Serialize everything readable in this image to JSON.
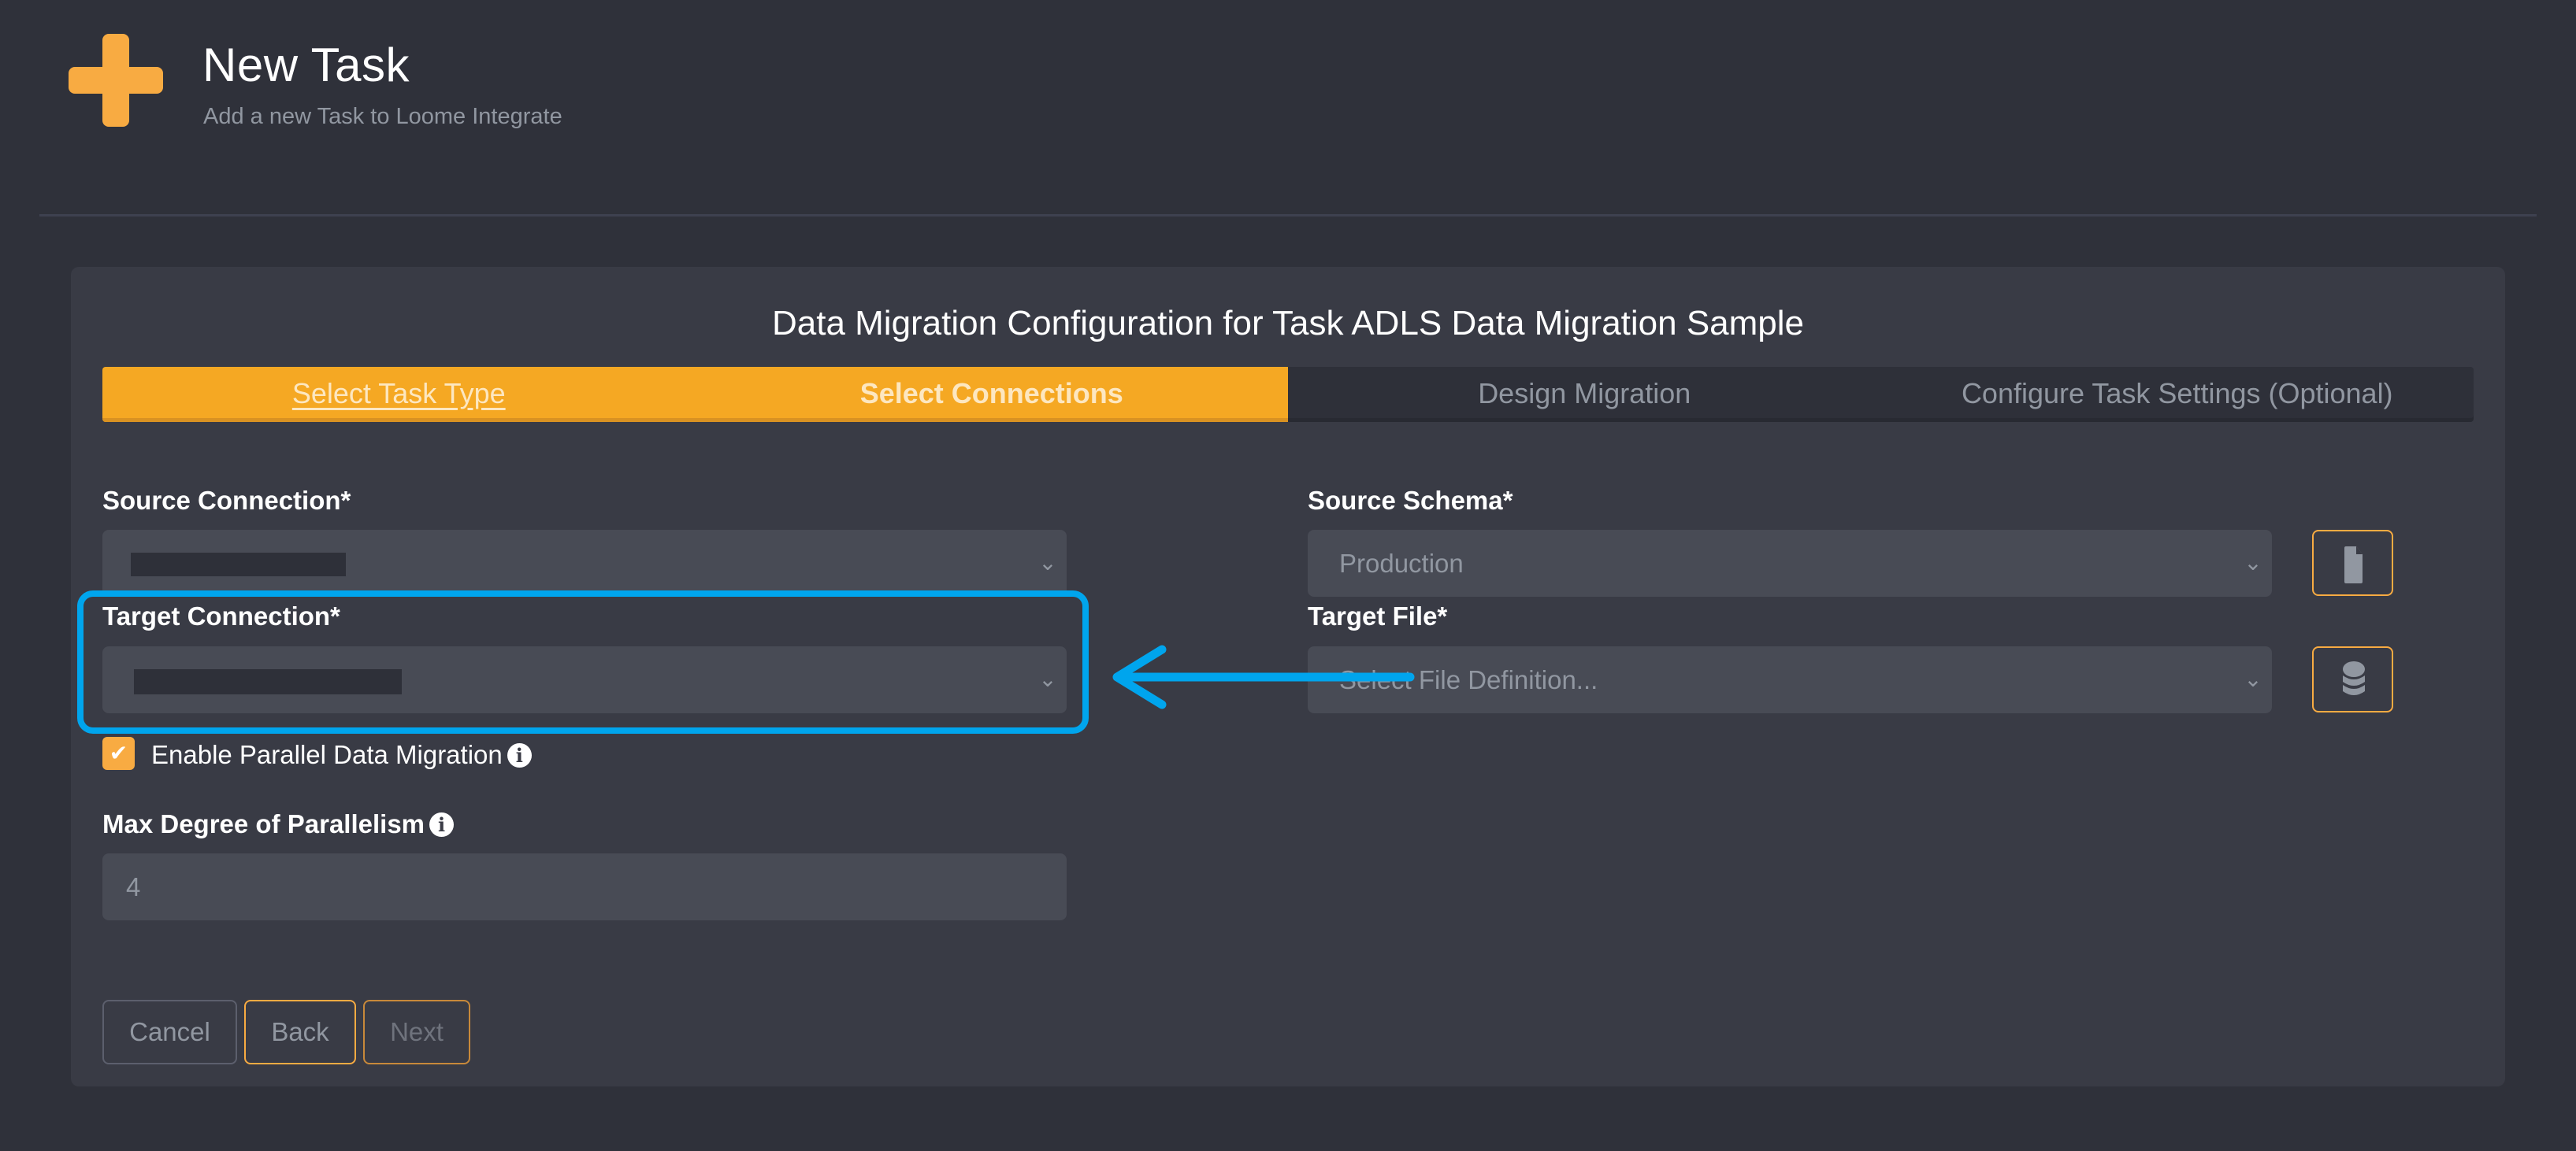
{
  "header": {
    "icon": "plus-icon",
    "title": "New Task",
    "subtitle": "Add a new Task to Loome Integrate"
  },
  "panel": {
    "title": "Data Migration Configuration for Task ADLS Data Migration Sample"
  },
  "steps": [
    {
      "label": "Select Task Type",
      "state": "visited"
    },
    {
      "label": "Select Connections",
      "state": "active"
    },
    {
      "label": "Design Migration",
      "state": "pending"
    },
    {
      "label": "Configure Task Settings (Optional)",
      "state": "pending"
    }
  ],
  "form": {
    "source_connection": {
      "label": "Source Connection*",
      "value": "[redacted]"
    },
    "target_connection": {
      "label": "Target Connection*",
      "value": "[redacted]"
    },
    "source_schema": {
      "label": "Source Schema*",
      "value": "Production",
      "button_icon": "file-icon"
    },
    "target_file": {
      "label": "Target File*",
      "placeholder": "Select File Definition...",
      "button_icon": "database-icon"
    },
    "parallel": {
      "label": "Enable Parallel Data Migration",
      "checked": true,
      "check_glyph": "✔",
      "info_glyph": "i"
    },
    "max_parallelism": {
      "label": "Max Degree of Parallelism",
      "value": "4",
      "info_glyph": "i"
    },
    "chevron_glyph": "⌄"
  },
  "buttons": {
    "cancel": "Cancel",
    "back": "Back",
    "next": "Next"
  },
  "annotation": {
    "color": "#00a5ed",
    "highlight_target": "target-connection"
  },
  "colors": {
    "accent": "#f8ab42",
    "step_active": "#f5a823",
    "background": "#2f313a",
    "panel": "#393b45",
    "field": "#484b55"
  }
}
